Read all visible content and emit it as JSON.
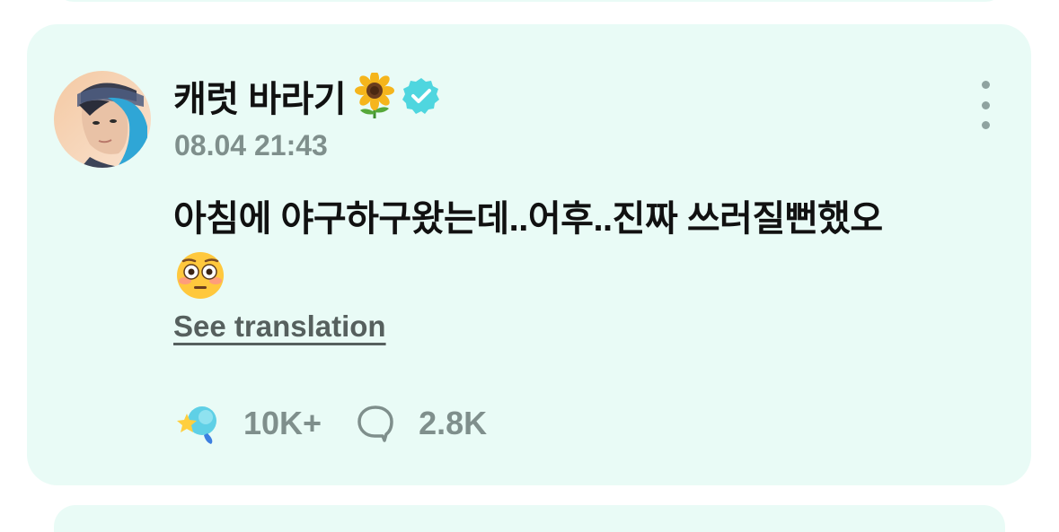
{
  "post": {
    "author": {
      "name": "캐럿 바라기",
      "name_emoji": "sunflower-emoji",
      "verified_icon": "verified-badge-icon",
      "avatar": "avatar"
    },
    "timestamp": "08.04 21:43",
    "text": "아침에 야구하구왔는데..어후..진짜 쓰러질뻔했오",
    "text_emoji": "flushed-face-emoji",
    "translate_label": "See translation",
    "stats": {
      "likes": "10K+",
      "comments": "2.8K"
    },
    "more_icon": "more-vertical-icon"
  },
  "colors": {
    "card_background": "#e9fbf6",
    "verified_badge": "#4fd6df",
    "muted_text": "#7f8f8c",
    "primary_text": "#111111"
  }
}
